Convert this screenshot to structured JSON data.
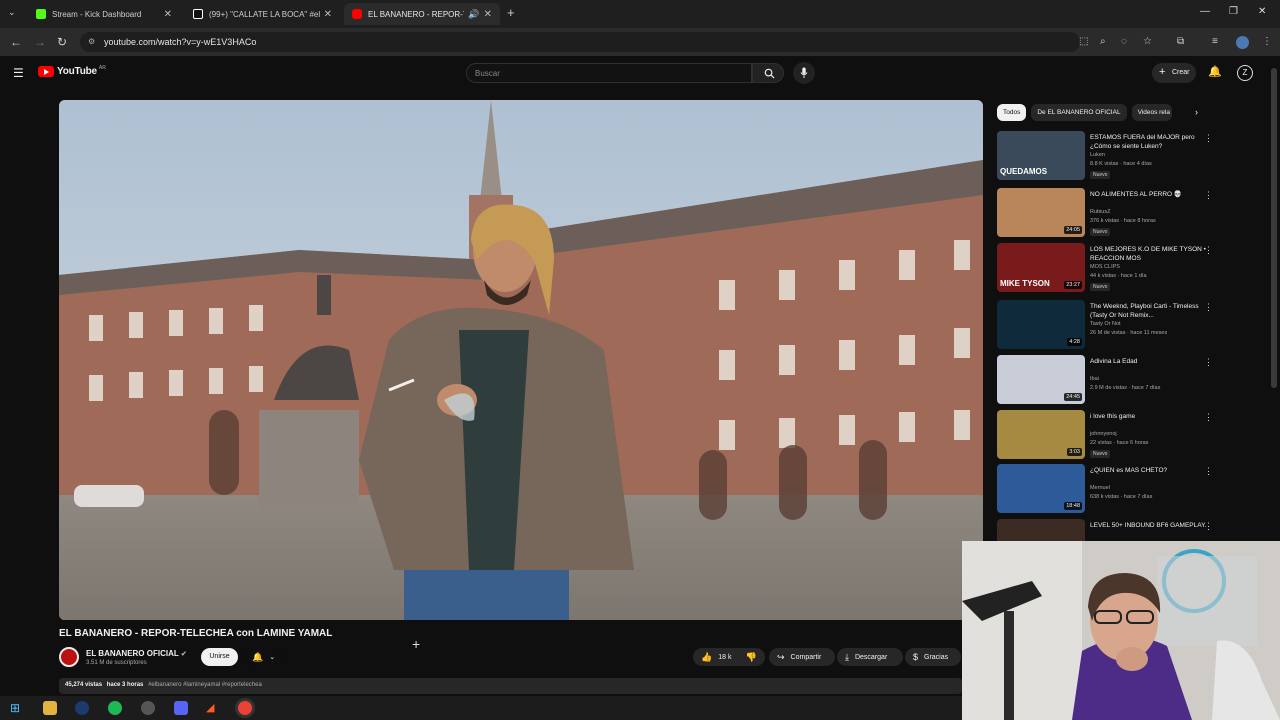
{
  "browser": {
    "tabs": [
      {
        "label": "Stream - Kick Dashboard",
        "color": "#53fc18"
      },
      {
        "label": "(99+) \"CALLATE LA BOCA\" #el",
        "color": "#ffffff"
      },
      {
        "label": "EL BANANERO - REPOR-TE",
        "color": "#ff0000",
        "active": true
      }
    ],
    "url": "youtube.com/watch?v=y-wE1V3HACo"
  },
  "youtube": {
    "logo_text": "YouTube",
    "country": "AR",
    "search_placeholder": "Buscar",
    "create_label": "Crear"
  },
  "video": {
    "title": "EL BANANERO - REPOR-TELECHEA con LAMINE YAMAL",
    "channel": "EL BANANERO OFICIAL",
    "subscribers": "3.51 M de suscriptores",
    "join_label": "Unirse",
    "likes": "18 k",
    "share_label": "Compartir",
    "download_label": "Descargar",
    "thanks_label": "Gracias",
    "views": "45,274 vistas",
    "age": "hace 3 horas",
    "hashtags": "#elbananero #lamineyamal #reportelechea"
  },
  "sidebar": {
    "chips": [
      "Todos",
      "De EL BANANERO OFICIAL",
      "Videos rela"
    ],
    "recommendations": [
      {
        "title": "ESTAMOS FUERA del MAJOR pero ¿Cómo se siente Luken?",
        "channel": "Luken",
        "meta": "8.8 K vistas · hace 4 días",
        "badge": "Nuevo",
        "duration": "",
        "thumb_text": "QUEDAMOS",
        "thumb_color": "#3a4a5a"
      },
      {
        "title": "NO ALIMENTES AL PERRO 💀",
        "channel": "RubiusZ",
        "meta": "376 k vistas · hace 8 horas",
        "badge": "Nuevo",
        "duration": "24:05",
        "thumb_text": "",
        "thumb_color": "#b9855a"
      },
      {
        "title": "LOS MEJORES K.O DE MIKE TYSON • REACCION MOS",
        "channel": "MOS CLIPS",
        "meta": "44 k vistas · hace 1 día",
        "badge": "Nuevo",
        "duration": "23:27",
        "thumb_text": "MIKE TYSON",
        "thumb_color": "#7a1b1b"
      },
      {
        "title": "The Weeknd, Playboi Carti - Timeless (Tasty Or Not Remix...",
        "channel": "Tasty Or Not",
        "meta": "26 M de vistas · hace 11 meses",
        "badge": "",
        "duration": "4:28",
        "thumb_text": "",
        "thumb_color": "#0f2a3a"
      },
      {
        "title": "Adivina La Edad",
        "channel": "Ibai",
        "meta": "2.9 M de vistas · hace 7 días",
        "badge": "",
        "duration": "24:45",
        "thumb_text": "",
        "thumb_color": "#c8ccd6"
      },
      {
        "title": "i love this game",
        "channel": "johnnyenoj",
        "meta": "22 vistas · hace 6 horas",
        "badge": "Nuevo",
        "duration": "3:03",
        "thumb_text": "",
        "thumb_color": "#a68a42"
      },
      {
        "title": "¿QUIEN es MAS CHETO?",
        "channel": "Mernuel",
        "meta": "638 k vistas · hace 7 días",
        "badge": "",
        "duration": "18:48",
        "thumb_text": "",
        "thumb_color": "#2d5b9a"
      },
      {
        "title": "LEVEL 50+ INBOUND BF6 GAMEPLAY.",
        "channel": "",
        "meta": "",
        "badge": "",
        "duration": "",
        "thumb_text": "",
        "thumb_color": "#3b2b22"
      }
    ]
  }
}
